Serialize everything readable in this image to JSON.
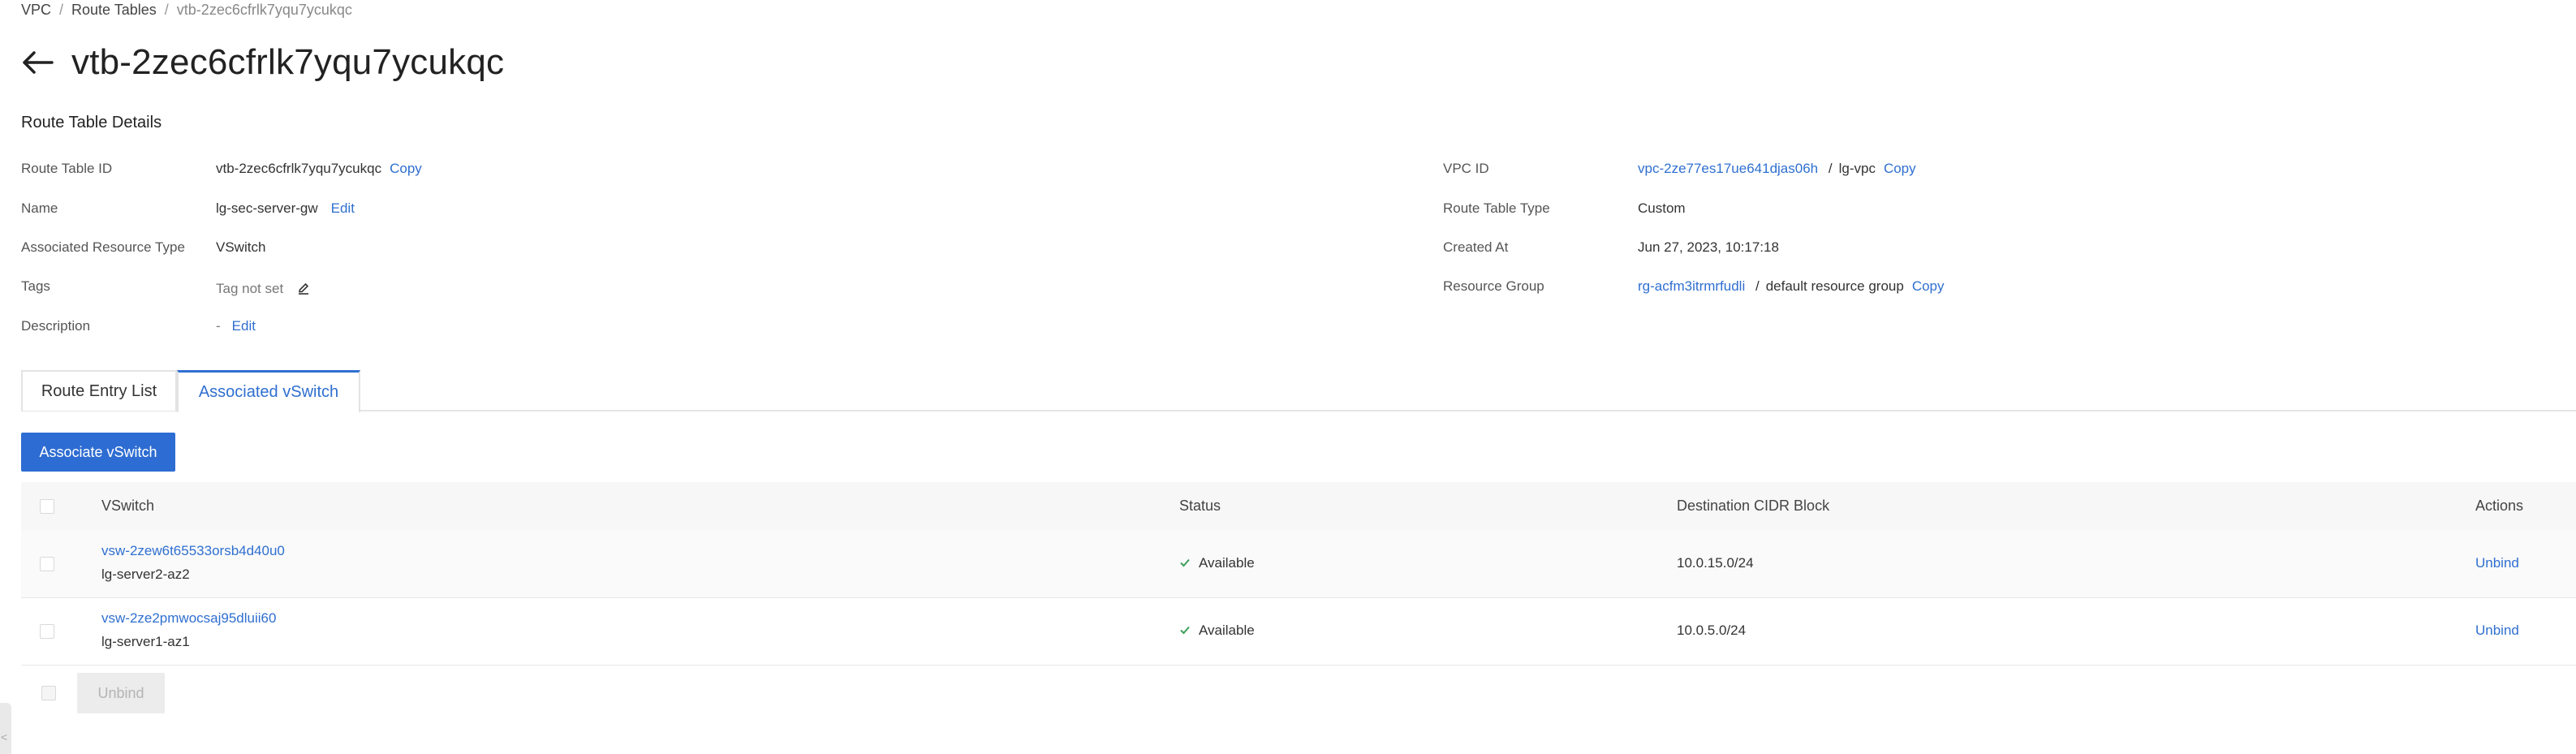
{
  "breadcrumb": [
    "VPC",
    "Route Tables",
    "vtb-2zec6cfrlk7yqu7ycukqc"
  ],
  "page_title": "vtb-2zec6cfrlk7yqu7ycukqc",
  "section_title": "Route Table Details",
  "details_left": {
    "route_table_id_label": "Route Table ID",
    "route_table_id_value": "vtb-2zec6cfrlk7yqu7ycukqc",
    "copy_label": "Copy",
    "name_label": "Name",
    "name_value": "lg-sec-server-gw",
    "edit_label": "Edit",
    "resource_type_label": "Associated Resource Type",
    "resource_type_value": "VSwitch",
    "tags_label": "Tags",
    "tags_value": "Tag not set",
    "description_label": "Description",
    "description_value": "-"
  },
  "details_right": {
    "vpc_id_label": "VPC ID",
    "vpc_id_value": "vpc-2ze77es17ue641djas06h",
    "vpc_sep": "/",
    "vpc_name": "lg-vpc",
    "route_table_type_label": "Route Table Type",
    "route_table_type_value": "Custom",
    "created_at_label": "Created At",
    "created_at_value": "Jun 27, 2023, 10:17:18",
    "resource_group_label": "Resource Group",
    "resource_group_id": "rg-acfm3itrmrfudli",
    "resource_group_sep": "/",
    "resource_group_name": "default resource group"
  },
  "tabs": [
    "Route Entry List",
    "Associated vSwitch"
  ],
  "active_tab": "Associated vSwitch",
  "associate_button": "Associate vSwitch",
  "table": {
    "headers": [
      "VSwitch",
      "Status",
      "Destination CIDR Block",
      "Actions"
    ],
    "rows": [
      {
        "vswitch_id": "vsw-2zew6t65533orsb4d40u0",
        "vswitch_name": "lg-server2-az2",
        "status": "Available",
        "cidr": "10.0.15.0/24",
        "action": "Unbind"
      },
      {
        "vswitch_id": "vsw-2ze2pmwocsaj95dluii60",
        "vswitch_name": "lg-server1-az1",
        "status": "Available",
        "cidr": "10.0.5.0/24",
        "action": "Unbind"
      }
    ]
  },
  "bulk_unbind_button": "Unbind",
  "edge_glyph": "<",
  "colors": {
    "accent": "#2f6fd0",
    "primary_button": "#2d6cd2",
    "status_check": "#3e9e5a"
  },
  "icons": {
    "back": "arrow-left-icon",
    "tag_edit": "pencil-icon",
    "status": "check-icon"
  }
}
